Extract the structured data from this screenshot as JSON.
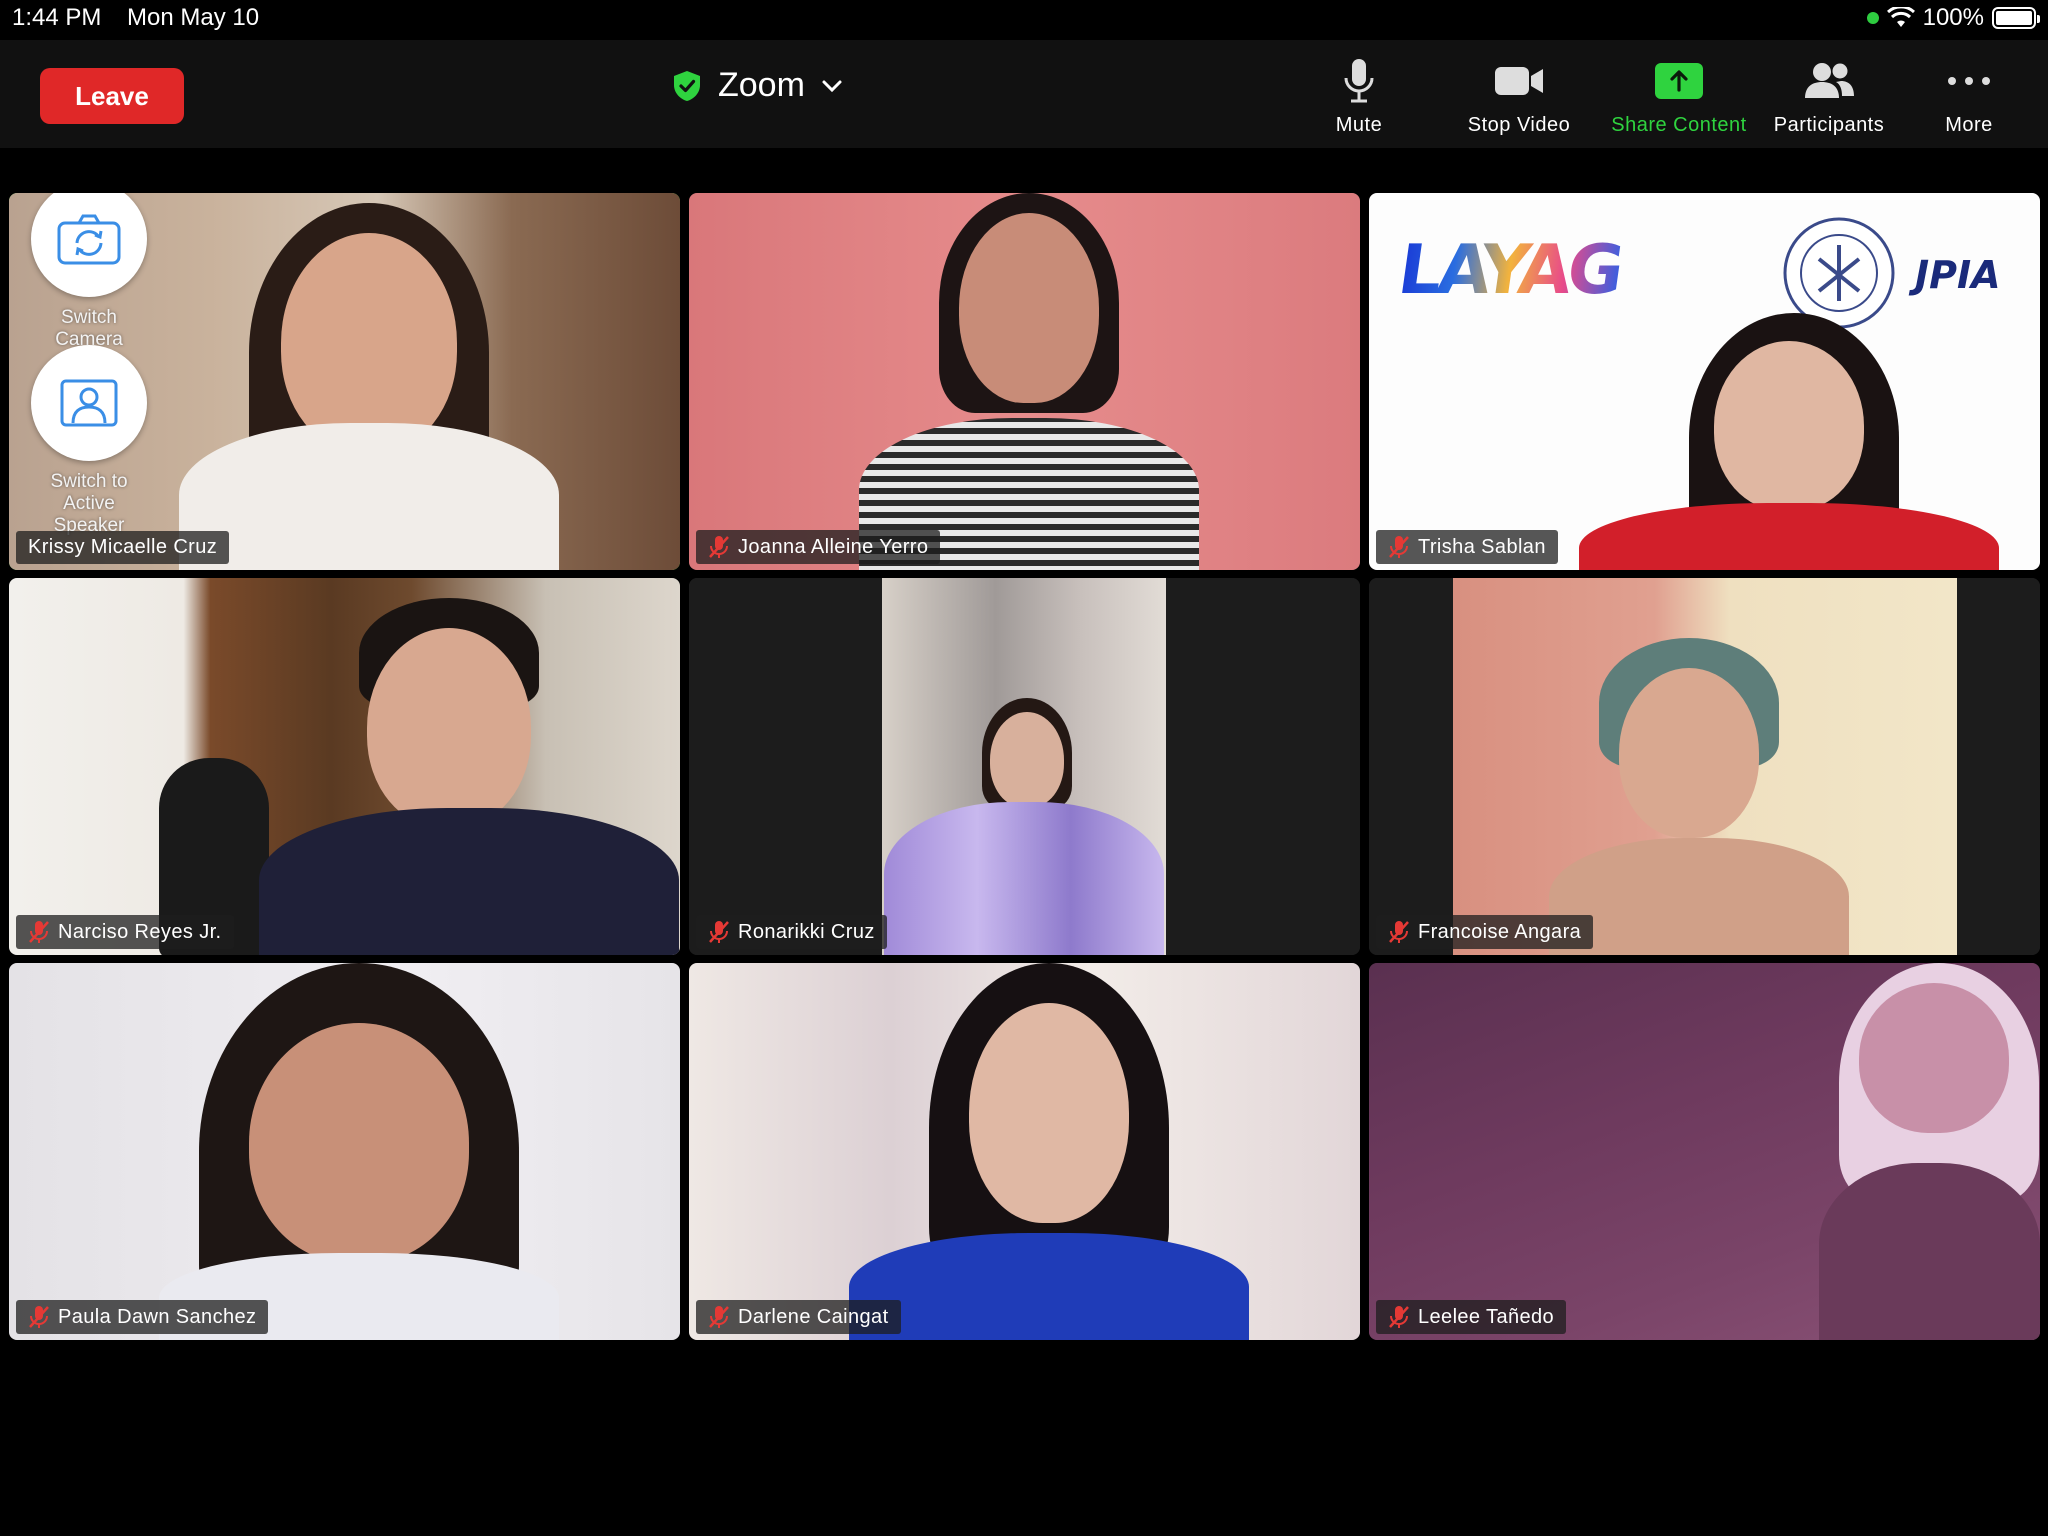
{
  "status_bar": {
    "time": "1:44 PM",
    "date": "Mon May 10",
    "battery": "100%",
    "battery_level": 1.0
  },
  "meeting": {
    "title": "Zoom"
  },
  "toolbar": {
    "leave_label": "Leave",
    "mute_label": "Mute",
    "stop_video_label": "Stop Video",
    "share_label": "Share Content",
    "participants_label": "Participants",
    "more_label": "More"
  },
  "colors": {
    "leave": "#e02828",
    "accent_green": "#2fd33f",
    "background": "#000000",
    "toolbar": "#111111"
  },
  "self_view": {
    "switch_camera_label": "Switch Camera",
    "switch_speaker_label_line1": "Switch to",
    "switch_speaker_label_line2": "Active Speaker"
  },
  "tile_logos": {
    "logo_left": "LAYAG",
    "logo_right": "JPIA"
  },
  "participants": [
    {
      "name": "Krissy Micaelle Cruz",
      "muted": false,
      "active": true
    },
    {
      "name": "Joanna Alleine Yerro",
      "muted": true
    },
    {
      "name": "Trisha Sablan",
      "muted": true
    },
    {
      "name": "Narciso Reyes Jr.",
      "muted": true
    },
    {
      "name": "Ronarikki Cruz",
      "muted": true
    },
    {
      "name": "Francoise Angara",
      "muted": true
    },
    {
      "name": "Paula Dawn Sanchez",
      "muted": true
    },
    {
      "name": "Darlene Caingat",
      "muted": true
    },
    {
      "name": "Leelee Tañedo",
      "muted": true
    }
  ]
}
